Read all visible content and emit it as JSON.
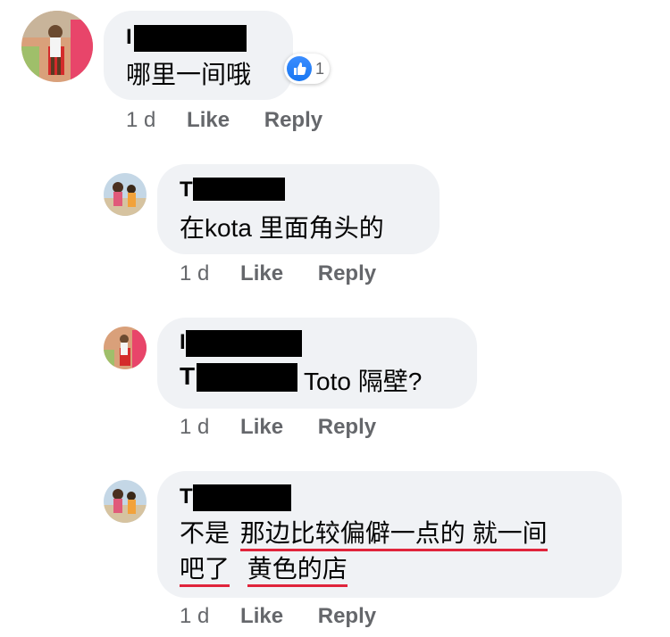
{
  "colors": {
    "bubble": "#f0f2f5",
    "meta_text": "#65676b",
    "underline": "#e0243b",
    "like_blue": "#1877f2"
  },
  "comments": [
    {
      "name_initial": "I",
      "text": "哪里一间哦",
      "reaction": {
        "icon": "thumbs-up-icon",
        "count": "1"
      },
      "meta": {
        "time": "1 d",
        "like": "Like",
        "reply": "Reply"
      }
    },
    {
      "name_initial": "T",
      "text": "在kota 里面角头的",
      "meta": {
        "time": "1 d",
        "like": "Like",
        "reply": "Reply"
      }
    },
    {
      "name_initial": "I",
      "mention_initial": "T",
      "text": "Toto 隔壁?",
      "meta": {
        "time": "1 d",
        "like": "Like",
        "reply": "Reply"
      }
    },
    {
      "name_initial": "T",
      "line1_part1": "不是",
      "line1_part2": "那边比较偏僻一点的 就一间",
      "line2_part1": "吧了",
      "line2_part2": "黄色的店",
      "meta": {
        "time": "1 d",
        "like": "Like",
        "reply": "Reply"
      }
    }
  ]
}
